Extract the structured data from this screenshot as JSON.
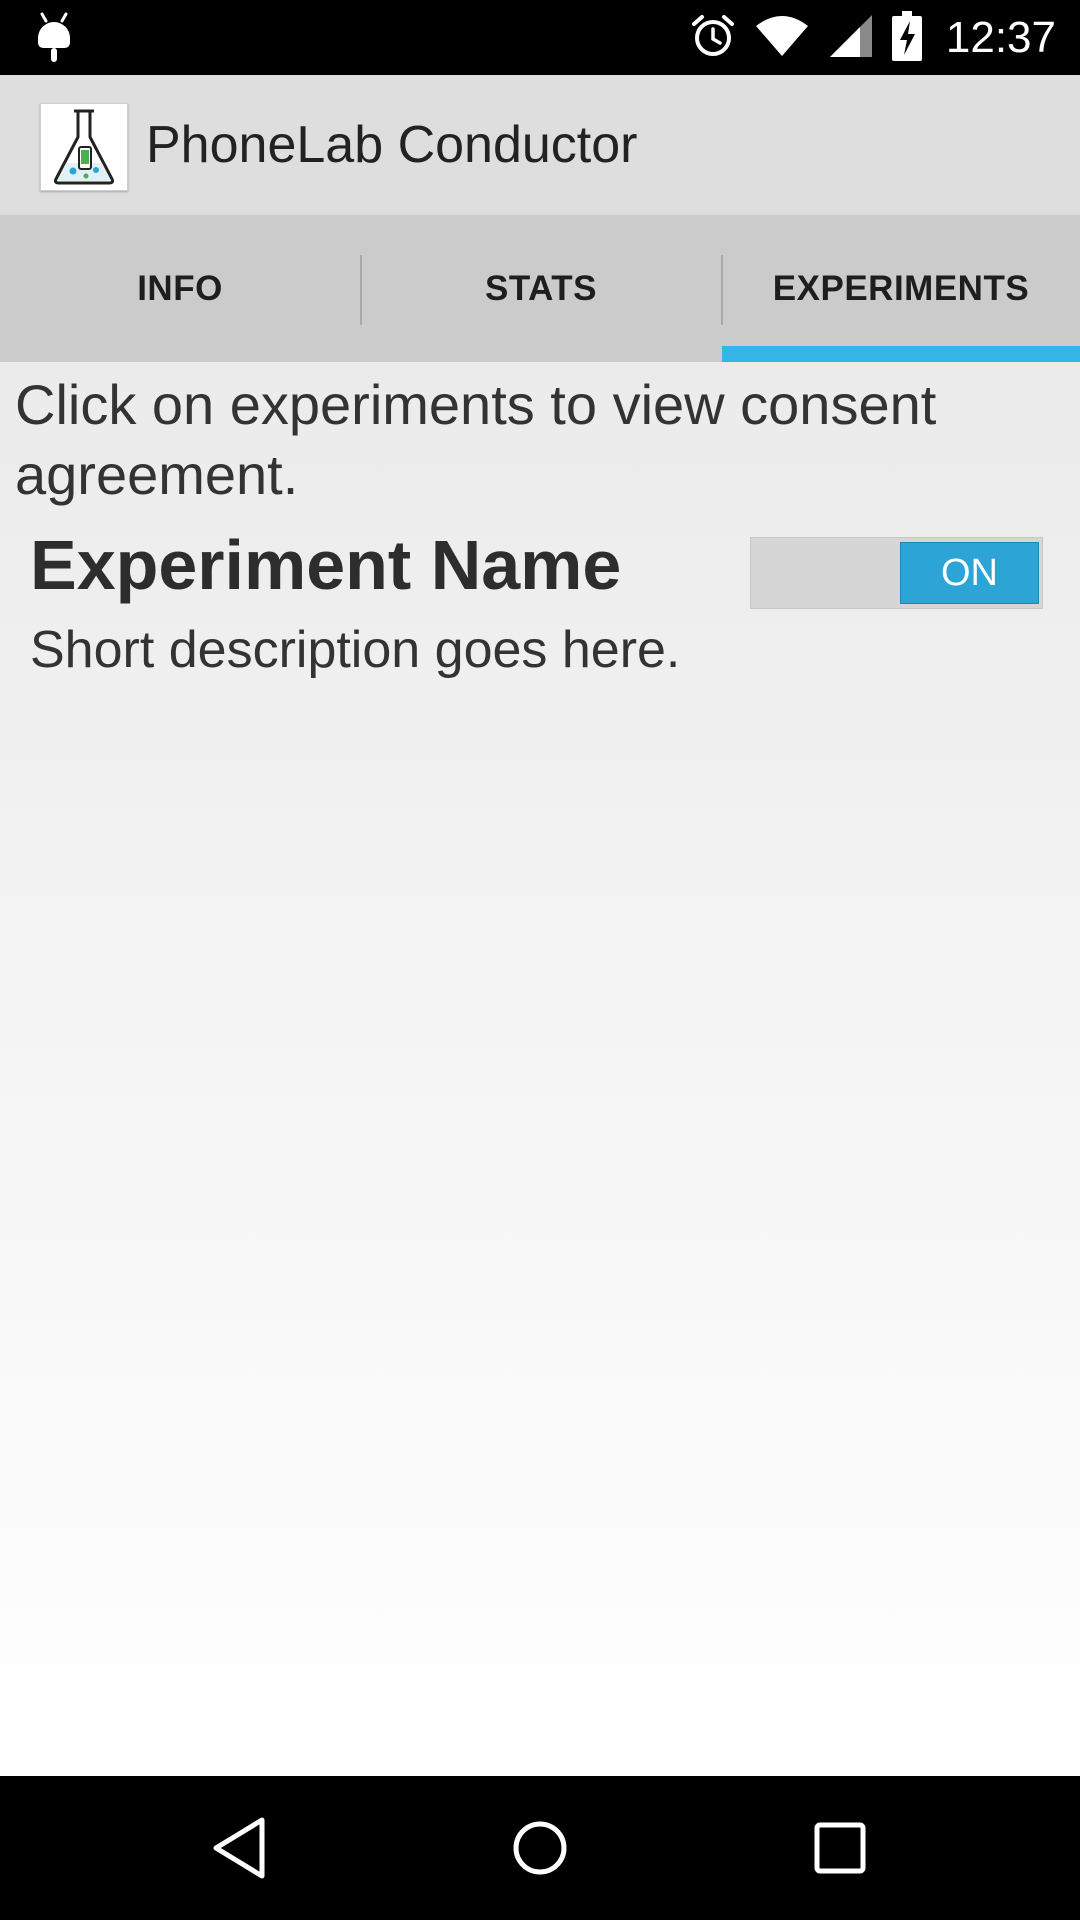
{
  "status_bar": {
    "time": "12:37",
    "icons": [
      "android-debug-icon",
      "alarm-icon",
      "wifi-icon",
      "cell-signal-icon",
      "battery-charging-icon"
    ]
  },
  "action_bar": {
    "title": "PhoneLab Conductor",
    "icon": "flask-app-icon"
  },
  "tabs": [
    {
      "label": "INFO",
      "selected": false
    },
    {
      "label": "STATS",
      "selected": false
    },
    {
      "label": "EXPERIMENTS",
      "selected": true
    }
  ],
  "content": {
    "hint": "Click on experiments to view consent agreement.",
    "experiments": [
      {
        "name": "Experiment Name",
        "description": "Short description goes here.",
        "toggle_label": "ON",
        "enabled": true
      }
    ]
  },
  "nav_bar": {
    "icons": [
      "back-icon",
      "home-icon",
      "recents-icon"
    ]
  },
  "colors": {
    "accent": "#33b5e5",
    "toggle_on": "#2da4d6",
    "status_bar": "#000000",
    "action_bar": "#dedede",
    "tab_bar": "#cbcbcb"
  }
}
